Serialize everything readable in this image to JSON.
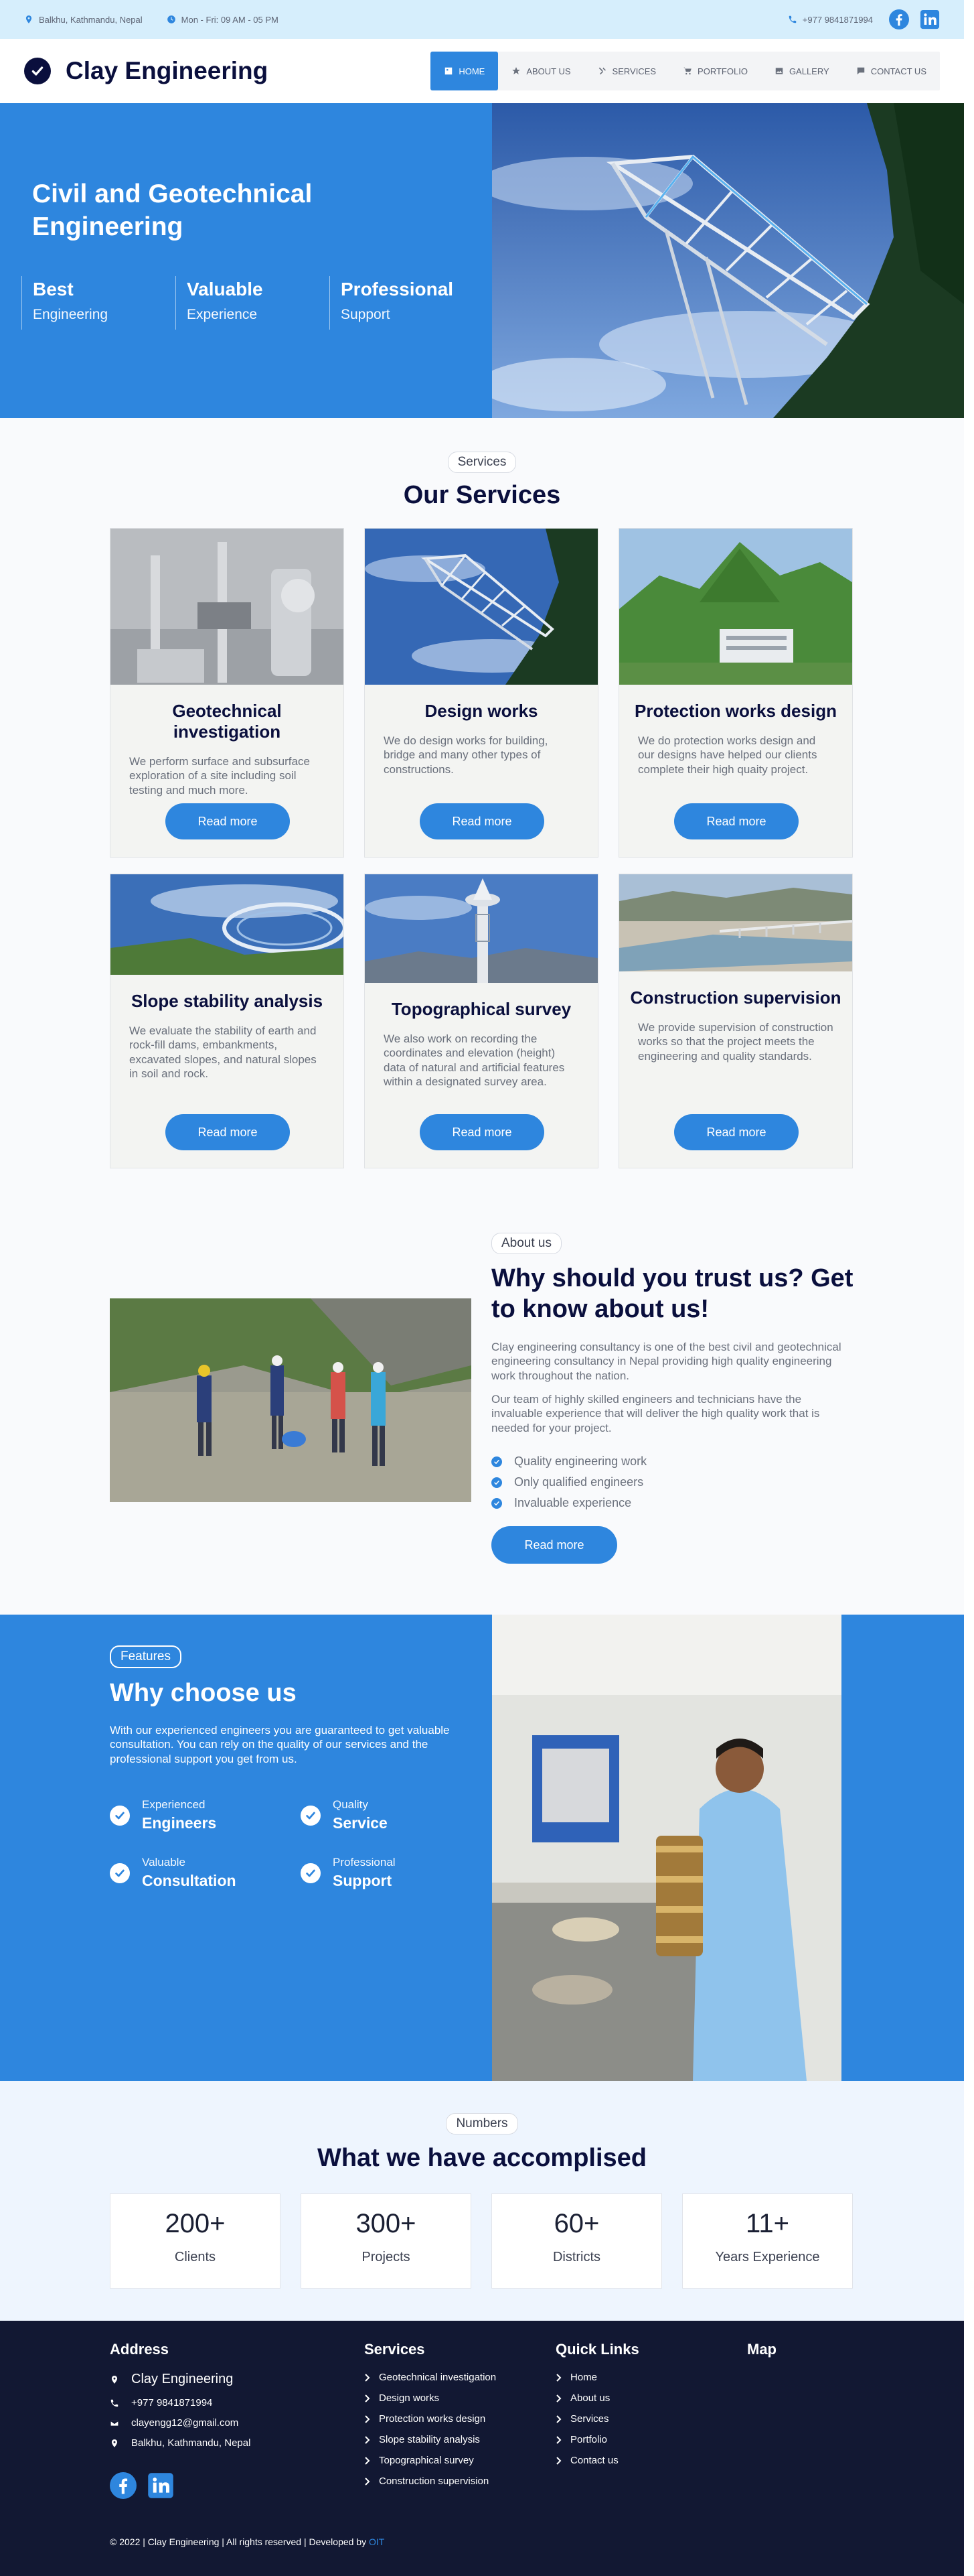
{
  "colors": {
    "accent": "#2e86de",
    "navy": "#0a0f3d",
    "topbar_bg": "#d6eefc",
    "footer_bg": "#121833"
  },
  "topbar": {
    "address": "Balkhu, Kathmandu, Nepal",
    "hours": "Mon - Fri: 09 AM - 05 PM",
    "phone": "+977 9841871994",
    "social": [
      "facebook-icon",
      "linkedin-icon"
    ]
  },
  "header": {
    "brand": "Clay Engineering",
    "nav": [
      {
        "label": "HOME",
        "icon": "home-icon"
      },
      {
        "label": "ABOUT US",
        "icon": "star-icon"
      },
      {
        "label": "SERVICES",
        "icon": "tools-icon"
      },
      {
        "label": "PORTFOLIO",
        "icon": "cart-icon"
      },
      {
        "label": "GALLERY",
        "icon": "image-icon"
      },
      {
        "label": "CONTACT US",
        "icon": "chat-icon"
      }
    ]
  },
  "hero": {
    "title": "Civil and Geotechnical Engineering",
    "features": [
      {
        "big": "Best",
        "small": "Engineering"
      },
      {
        "big": "Valuable",
        "small": "Experience"
      },
      {
        "big": "Professional",
        "small": "Support"
      }
    ]
  },
  "services": {
    "pill": "Services",
    "heading": "Our Services",
    "read_more": "Read more",
    "cards": [
      {
        "title": "Geotechnical investigation",
        "text": "We perform surface and subsurface exploration of a site including soil testing and much more."
      },
      {
        "title": "Design works",
        "text": "We do design works for building, bridge and many other types of constructions."
      },
      {
        "title": "Protection works design",
        "text": "We do protection works design and our designs have helped our clients complete their high quaity project."
      },
      {
        "title": "Slope stability analysis",
        "text": "We evaluate the stability of earth and rock-fill dams, embankments, excavated slopes, and natural slopes in soil and rock."
      },
      {
        "title": "Topographical survey",
        "text": "We also work on recording the coordinates and elevation (height) data of natural and artificial features within a designated survey area."
      },
      {
        "title": "Construction supervision",
        "text": "We provide supervision of construction works so that the project meets the engineering and quality standards."
      }
    ]
  },
  "about": {
    "pill": "About us",
    "heading": "Why should you trust us? Get to know about us!",
    "p1": "Clay engineering consultancy is one of the best civil and geotechnical engineering consultancy in Nepal providing high quality engineering work throughout the nation.",
    "p2": "Our team of highly skilled engineers and technicians have the invaluable experience that will deliver the high quality work that is needed for your project.",
    "list": [
      "Quality engineering work",
      "Only qualified engineers",
      "Invaluable experience"
    ],
    "button": "Read more"
  },
  "features": {
    "pill": "Features",
    "heading": "Why choose us",
    "text": "With our experienced engineers you are guaranteed to get valuable consultation. You can rely on the quality of our services and the professional support you get from us.",
    "items": [
      {
        "small": "Experienced",
        "big": "Engineers"
      },
      {
        "small": "Quality",
        "big": "Service"
      },
      {
        "small": "Valuable",
        "big": "Consultation"
      },
      {
        "small": "Professional",
        "big": "Support"
      }
    ]
  },
  "numbers": {
    "pill": "Numbers",
    "heading": "What we have accomplised",
    "stats": [
      {
        "value": "200+",
        "label": "Clients"
      },
      {
        "value": "300+",
        "label": "Projects"
      },
      {
        "value": "60+",
        "label": "Districts"
      },
      {
        "value": "11+",
        "label": "Years Experience"
      }
    ]
  },
  "footer": {
    "address_h": "Address",
    "company": "Clay Engineering",
    "phone": "+977 9841871994",
    "email": "clayengg12@gmail.com",
    "location": "Balkhu, Kathmandu, Nepal",
    "services_h": "Services",
    "services": [
      "Geotechnical investigation",
      "Design works",
      "Protection works design",
      "Slope stability analysis",
      "Topographical survey",
      "Construction supervision"
    ],
    "links_h": "Quick Links",
    "links": [
      "Home",
      "About us",
      "Services",
      "Portfolio",
      "Contact us"
    ],
    "map_h": "Map",
    "copyright": "© 2022 | Clay Engineering | All rights reserved | Developed by",
    "developer": "OIT"
  }
}
